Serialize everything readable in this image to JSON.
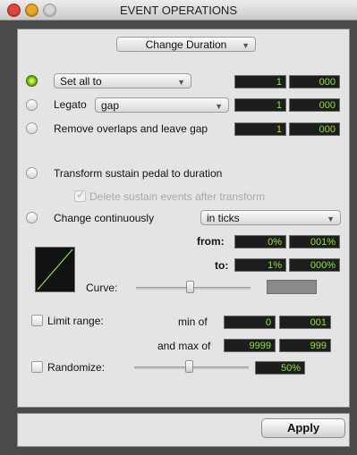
{
  "window": {
    "title": "EVENT OPERATIONS"
  },
  "operation_select": {
    "value": "Change Duration"
  },
  "set_all_to": {
    "value": "Set all to",
    "field_1": "1",
    "field_2": "000"
  },
  "legato": {
    "label": "Legato",
    "value": "gap",
    "field_1": "1",
    "field_2": "000"
  },
  "remove_overlaps": {
    "label": "Remove overlaps and leave gap",
    "field_1": "1",
    "field_2": "000"
  },
  "transform_sustain": {
    "label": "Transform sustain pedal to duration",
    "delete_label": "Delete sustain events after transform"
  },
  "change_continuously": {
    "label": "Change continuously",
    "units": "in ticks",
    "from_label": "from:",
    "from_1": "0%",
    "from_2": "001%",
    "to_label": "to:",
    "to_1": "1%",
    "to_2": "000%",
    "curve_label": "Curve:"
  },
  "limit_range": {
    "label": "Limit range:",
    "min_label": "min of",
    "min_1": "0",
    "min_2": "001",
    "max_label": "and max of",
    "max_1": "9999",
    "max_2": "999"
  },
  "randomize": {
    "label": "Randomize:",
    "value": "50%"
  },
  "footer": {
    "apply_label": "Apply"
  },
  "colors": {
    "lcd_text": "#8fe23a",
    "selected_radio": "#a6e32a"
  },
  "icons": {
    "close": "close-icon",
    "minimize": "minimize-icon",
    "zoom": "zoom-icon",
    "dropdown": "chevron-down-icon",
    "checkmark": "check-icon"
  }
}
